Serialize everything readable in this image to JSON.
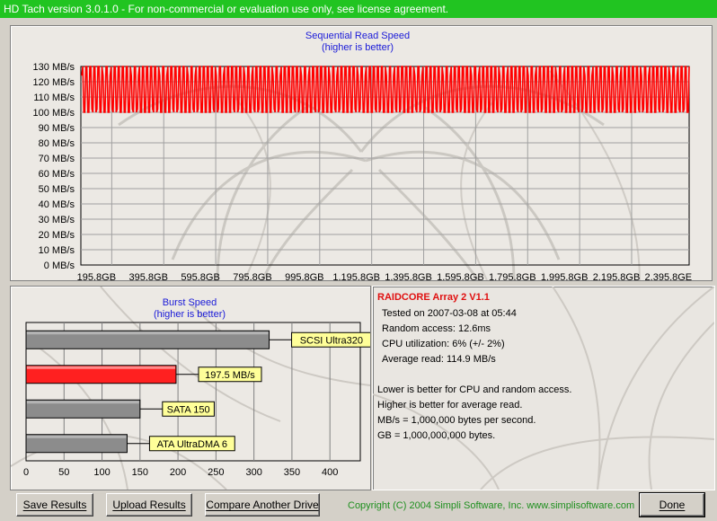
{
  "window": {
    "title": "HD Tach version 3.0.1.0  - For non-commercial or evaluation use only, see license agreement."
  },
  "read_chart": {
    "title": "Sequential Read Speed",
    "subtitle": "(higher is better)",
    "y_ticks": [
      "130 MB/s",
      "120 MB/s",
      "110 MB/s",
      "100 MB/s",
      "90 MB/s",
      "80 MB/s",
      "70 MB/s",
      "60 MB/s",
      "50 MB/s",
      "40 MB/s",
      "30 MB/s",
      "20 MB/s",
      "10 MB/s",
      "0 MB/s"
    ],
    "x_ticks": [
      "195.8GB",
      "395.8GB",
      "595.8GB",
      "795.8GB",
      "995.8GB",
      "1,195.8GB",
      "1,395.8GB",
      "1,595.8GB",
      "1,795.8GB",
      "1,995.8GB",
      "2,195.8GB",
      "2,395.8GE"
    ]
  },
  "chart_data": {
    "type": "line",
    "ylim": [
      0,
      130
    ],
    "xlim": [
      0,
      2395.8
    ],
    "series": [
      {
        "color": "#ff0000",
        "min_value": 100,
        "max_value": 130,
        "mean_value": 114.9,
        "cycles": 150
      }
    ]
  },
  "burst_chart": {
    "title": "Burst Speed",
    "subtitle": "(higher is better)",
    "x_ticks": [
      "0",
      "50",
      "100",
      "150",
      "200",
      "250",
      "300",
      "350",
      "400"
    ],
    "xlim": [
      0,
      440
    ],
    "bars": [
      {
        "label": "SCSI Ultra320",
        "value": 320,
        "color": "#8c8c8c",
        "highlight": false
      },
      {
        "label": "197.5 MB/s",
        "value": 197.5,
        "color": "#ff2020",
        "highlight": true
      },
      {
        "label": "SATA 150",
        "value": 150,
        "color": "#8c8c8c",
        "highlight": false
      },
      {
        "label": "ATA UltraDMA 6",
        "value": 133,
        "color": "#8c8c8c",
        "highlight": false
      }
    ]
  },
  "info": {
    "drive_name": "RAIDCORE Array 2 V1.1",
    "tested_on": "Tested on 2007-03-08 at 05:44",
    "random_access": "Random access: 12.6ms",
    "cpu_utilization": "CPU utilization: 6% (+/- 2%)",
    "average_read": "Average read: 114.9 MB/s",
    "note1": "Lower is better for CPU and random access.",
    "note2": "Higher is better for average read.",
    "note3": "MB/s = 1,000,000 bytes per second.",
    "note4": "GB = 1,000,000,000 bytes."
  },
  "footer": {
    "save_label": "Save Results",
    "upload_label": "Upload Results",
    "compare_label": "Compare Another Drive",
    "copyright": "Copyright (C) 2004 Simpli Software, Inc. www.simplisoftware.com",
    "done_label": "Done"
  }
}
